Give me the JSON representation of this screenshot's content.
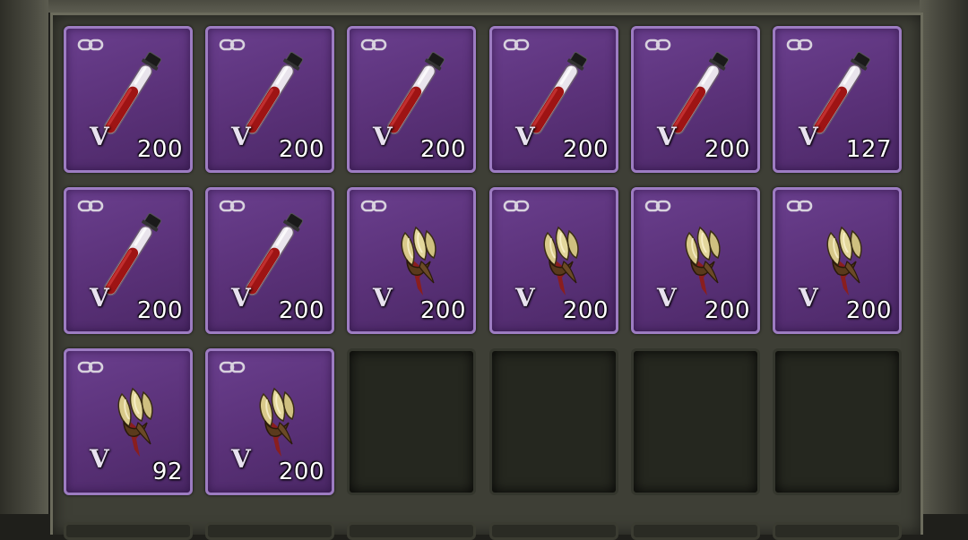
{
  "inventory": {
    "slots": [
      {
        "item": "blood-vial",
        "grade": "V",
        "qty": "200"
      },
      {
        "item": "blood-vial",
        "grade": "V",
        "qty": "200"
      },
      {
        "item": "blood-vial",
        "grade": "V",
        "qty": "200"
      },
      {
        "item": "blood-vial",
        "grade": "V",
        "qty": "200"
      },
      {
        "item": "blood-vial",
        "grade": "V",
        "qty": "200"
      },
      {
        "item": "blood-vial",
        "grade": "V",
        "qty": "127"
      },
      {
        "item": "blood-vial",
        "grade": "V",
        "qty": "200"
      },
      {
        "item": "blood-vial",
        "grade": "V",
        "qty": "200"
      },
      {
        "item": "beast-fangs",
        "grade": "V",
        "qty": "200"
      },
      {
        "item": "beast-fangs",
        "grade": "V",
        "qty": "200"
      },
      {
        "item": "beast-fangs",
        "grade": "V",
        "qty": "200"
      },
      {
        "item": "beast-fangs",
        "grade": "V",
        "qty": "200"
      },
      {
        "item": "beast-fangs",
        "grade": "V",
        "qty": "92"
      },
      {
        "item": "beast-fangs",
        "grade": "V",
        "qty": "200"
      },
      {
        "item": null
      },
      {
        "item": null
      },
      {
        "item": null
      },
      {
        "item": null
      }
    ]
  },
  "colors": {
    "slot_bg": "#5a3178",
    "slot_border": "#9d7cc2",
    "panel_bg": "#3e3f36"
  }
}
